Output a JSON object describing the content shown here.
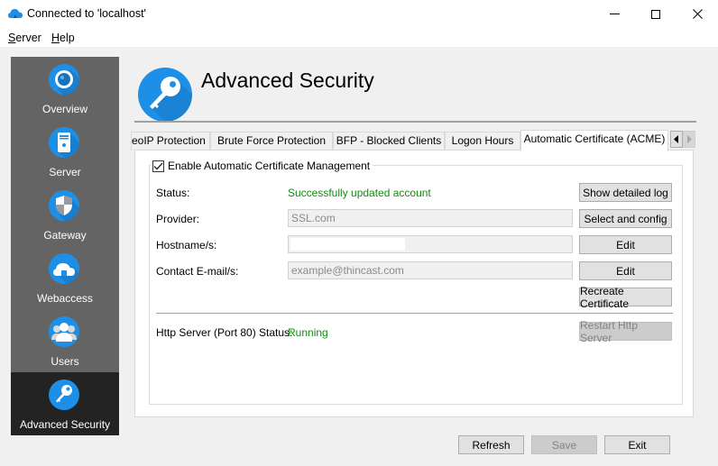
{
  "window": {
    "title": "Connected to 'localhost'",
    "controls": {
      "minimize": "minimize",
      "maximize": "maximize",
      "close": "close"
    }
  },
  "menu": [
    {
      "label": "Server",
      "mnemonic": "S",
      "rest": "erver"
    },
    {
      "label": "Help",
      "mnemonic": "H",
      "rest": "elp"
    }
  ],
  "sidebar": {
    "items": [
      {
        "label": "Overview",
        "icon": "eye-icon",
        "active": false
      },
      {
        "label": "Server",
        "icon": "server-icon",
        "active": false
      },
      {
        "label": "Gateway",
        "icon": "shield-icon",
        "active": false
      },
      {
        "label": "Webaccess",
        "icon": "cloud-icon",
        "active": false
      },
      {
        "label": "Users",
        "icon": "users-icon",
        "active": false
      },
      {
        "label": "Advanced Security",
        "icon": "key-icon",
        "active": true
      }
    ]
  },
  "header": {
    "title": "Advanced Security",
    "icon": "key-icon"
  },
  "tabs": [
    {
      "label": "GeoIP Protection",
      "visible_label": "eoIP Protection",
      "active": false
    },
    {
      "label": "Brute Force Protection",
      "active": false
    },
    {
      "label": "BFP - Blocked Clients",
      "active": false
    },
    {
      "label": "Logon Hours",
      "active": false
    },
    {
      "label": "Automatic Certificate (ACME)",
      "active": true
    }
  ],
  "acme": {
    "enable_label": "Enable Automatic Certificate Management",
    "enabled": true,
    "status": {
      "label": "Status:",
      "value": "Successfully updated account"
    },
    "provider": {
      "label": "Provider:",
      "value": "SSL.com"
    },
    "hostnames": {
      "label": "Hostname/s:",
      "value": ""
    },
    "contact": {
      "label": "Contact E-mail/s:",
      "value": "example@thincast.com"
    },
    "buttons": {
      "show_log": "Show detailed log",
      "select_config": "Select and config",
      "edit_hostnames": "Edit",
      "edit_contact": "Edit",
      "recreate": "Recreate Certificate",
      "restart_http": "Restart Http Server"
    },
    "http_server": {
      "label": "Http Server (Port 80) Status:",
      "value": "Running"
    }
  },
  "footer": {
    "refresh": "Refresh",
    "save": "Save",
    "exit": "Exit"
  },
  "colors": {
    "accent": "#1e8fe6",
    "success": "#118a11",
    "sidebar_bg": "#646464",
    "sidebar_active": "#232323"
  }
}
